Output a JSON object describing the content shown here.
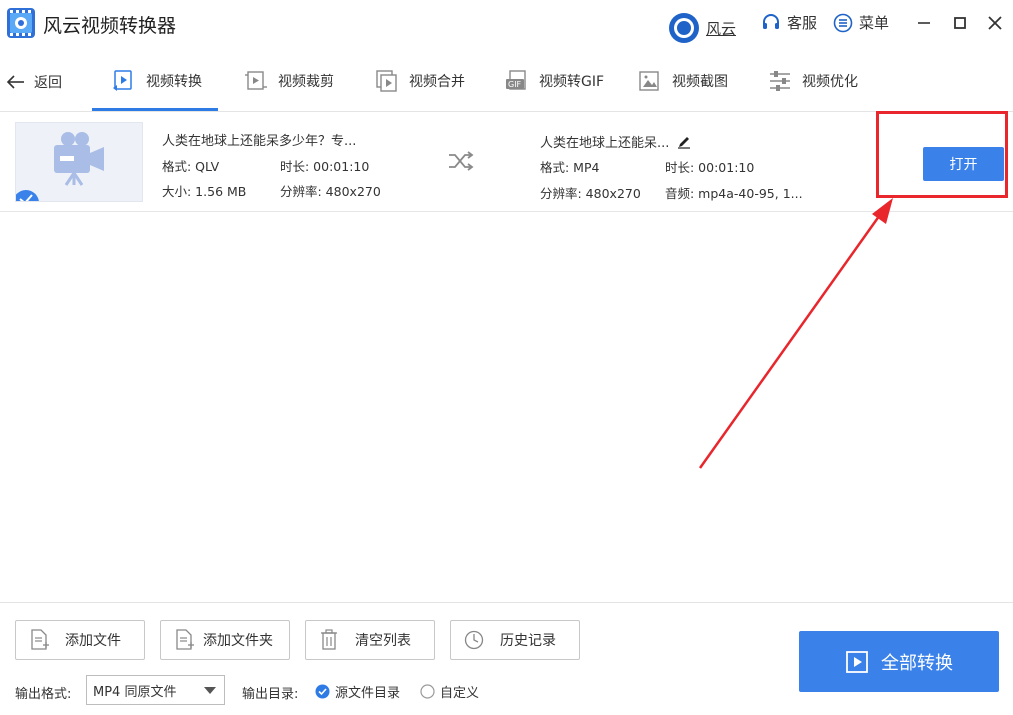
{
  "window": {
    "title": "风云视频转换器",
    "user_label": "风云",
    "service_label": "客服",
    "menu_label": "菜单"
  },
  "nav": {
    "back_label": "返回",
    "tabs": [
      {
        "label": "视频转换",
        "icon": "video-convert-icon",
        "active": true
      },
      {
        "label": "视频裁剪",
        "icon": "video-crop-icon",
        "active": false
      },
      {
        "label": "视频合并",
        "icon": "video-merge-icon",
        "active": false
      },
      {
        "label": "视频转GIF",
        "icon": "gif-icon",
        "active": false
      },
      {
        "label": "视频截图",
        "icon": "screenshot-icon",
        "active": false
      },
      {
        "label": "视频优化",
        "icon": "optimize-icon",
        "active": false
      }
    ]
  },
  "file": {
    "source": {
      "name": "人类在地球上还能呆多少年？专...",
      "format": "格式: QLV",
      "duration": "时长: 00:01:10",
      "size": "大小: 1.56 MB",
      "resolution": "分辨率: 480x270"
    },
    "output": {
      "name": "人类在地球上还能呆...",
      "format": "格式: MP4",
      "duration": "时长: 00:01:10",
      "resolution": "分辨率: 480x270",
      "audio": "音频: mp4a-40-95, 1..."
    },
    "open_label": "打开",
    "checked": true
  },
  "bottom": {
    "add_file_label": "添加文件",
    "add_folder_label": "添加文件夹",
    "clear_list_label": "清空列表",
    "history_label": "历史记录",
    "convert_all_label": "全部转换",
    "output_format_label": "输出格式:",
    "output_format_value": "MP4 同原文件",
    "output_dir_label": "输出目录:",
    "dir_options": [
      {
        "label": "源文件目录",
        "selected": true
      },
      {
        "label": "自定义",
        "selected": false
      }
    ]
  },
  "colors": {
    "accent": "#3a82ea",
    "annotation_red": "#e8262c"
  }
}
